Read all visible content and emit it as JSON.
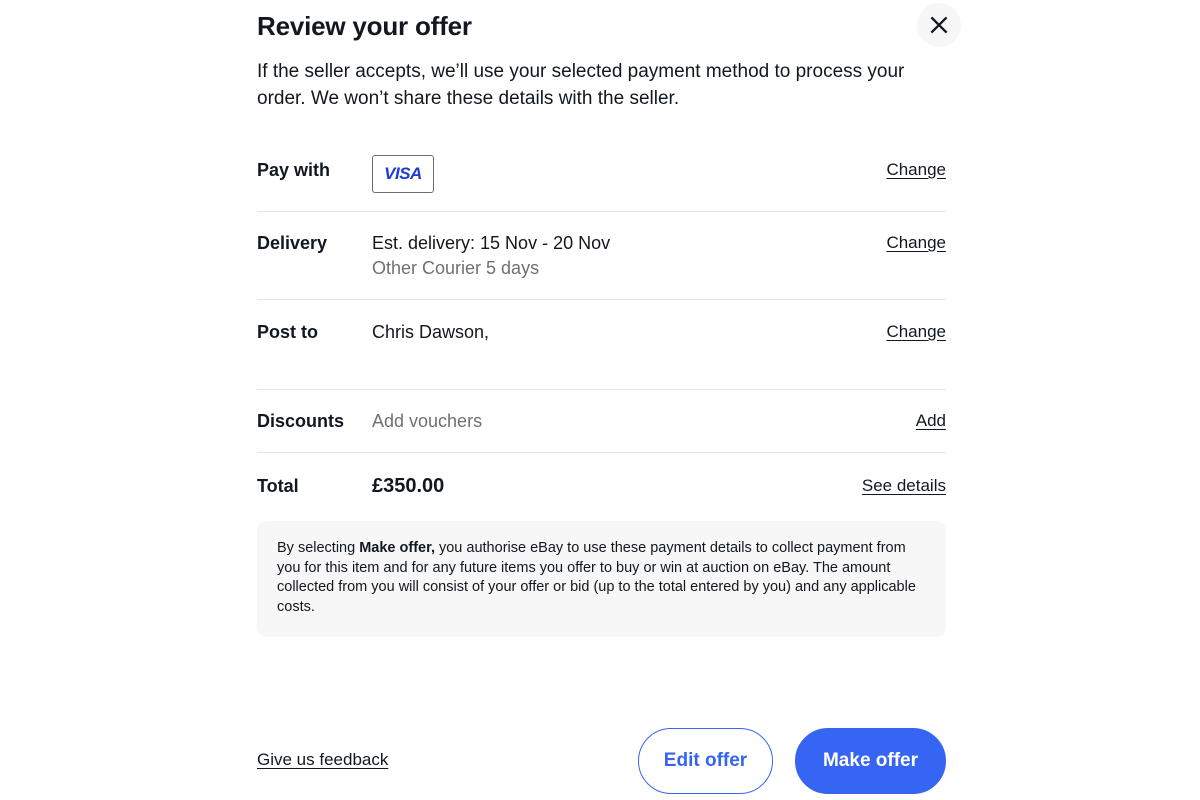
{
  "header": {
    "title": "Review your offer",
    "close_icon": "close-icon",
    "intro": "If the seller accepts, we’ll use your selected payment method to process your order. We won’t share these details with the seller."
  },
  "rows": {
    "pay_with": {
      "label": "Pay with",
      "card_brand": "VISA",
      "action": "Change"
    },
    "delivery": {
      "label": "Delivery",
      "value": "Est. delivery: 15 Nov - 20 Nov",
      "sub": "Other Courier 5 days",
      "action": "Change"
    },
    "post_to": {
      "label": "Post to",
      "value": "Chris Dawson,",
      "action": "Change"
    },
    "discounts": {
      "label": "Discounts",
      "placeholder": "Add vouchers",
      "action": "Add"
    },
    "total": {
      "label": "Total",
      "amount": "£350.00",
      "action": "See details"
    }
  },
  "disclaimer": {
    "lead": "By selecting ",
    "bold": "Make offer,",
    "rest": " you authorise eBay to use these payment details to collect payment from you for this item and for any future items you offer to buy or win at auction on eBay. The amount collected from you will consist of your offer or bid (up to the total entered by you) and any applicable costs."
  },
  "footer": {
    "feedback_label": "Give us feedback",
    "edit_label": "Edit offer",
    "submit_label": "Make offer"
  },
  "colors": {
    "accent": "#3665f3",
    "text": "#111820",
    "muted": "#707070",
    "divider": "#e5e5e5",
    "panel_grey": "#f7f7f7",
    "visa_blue": "#1a3bd6"
  }
}
